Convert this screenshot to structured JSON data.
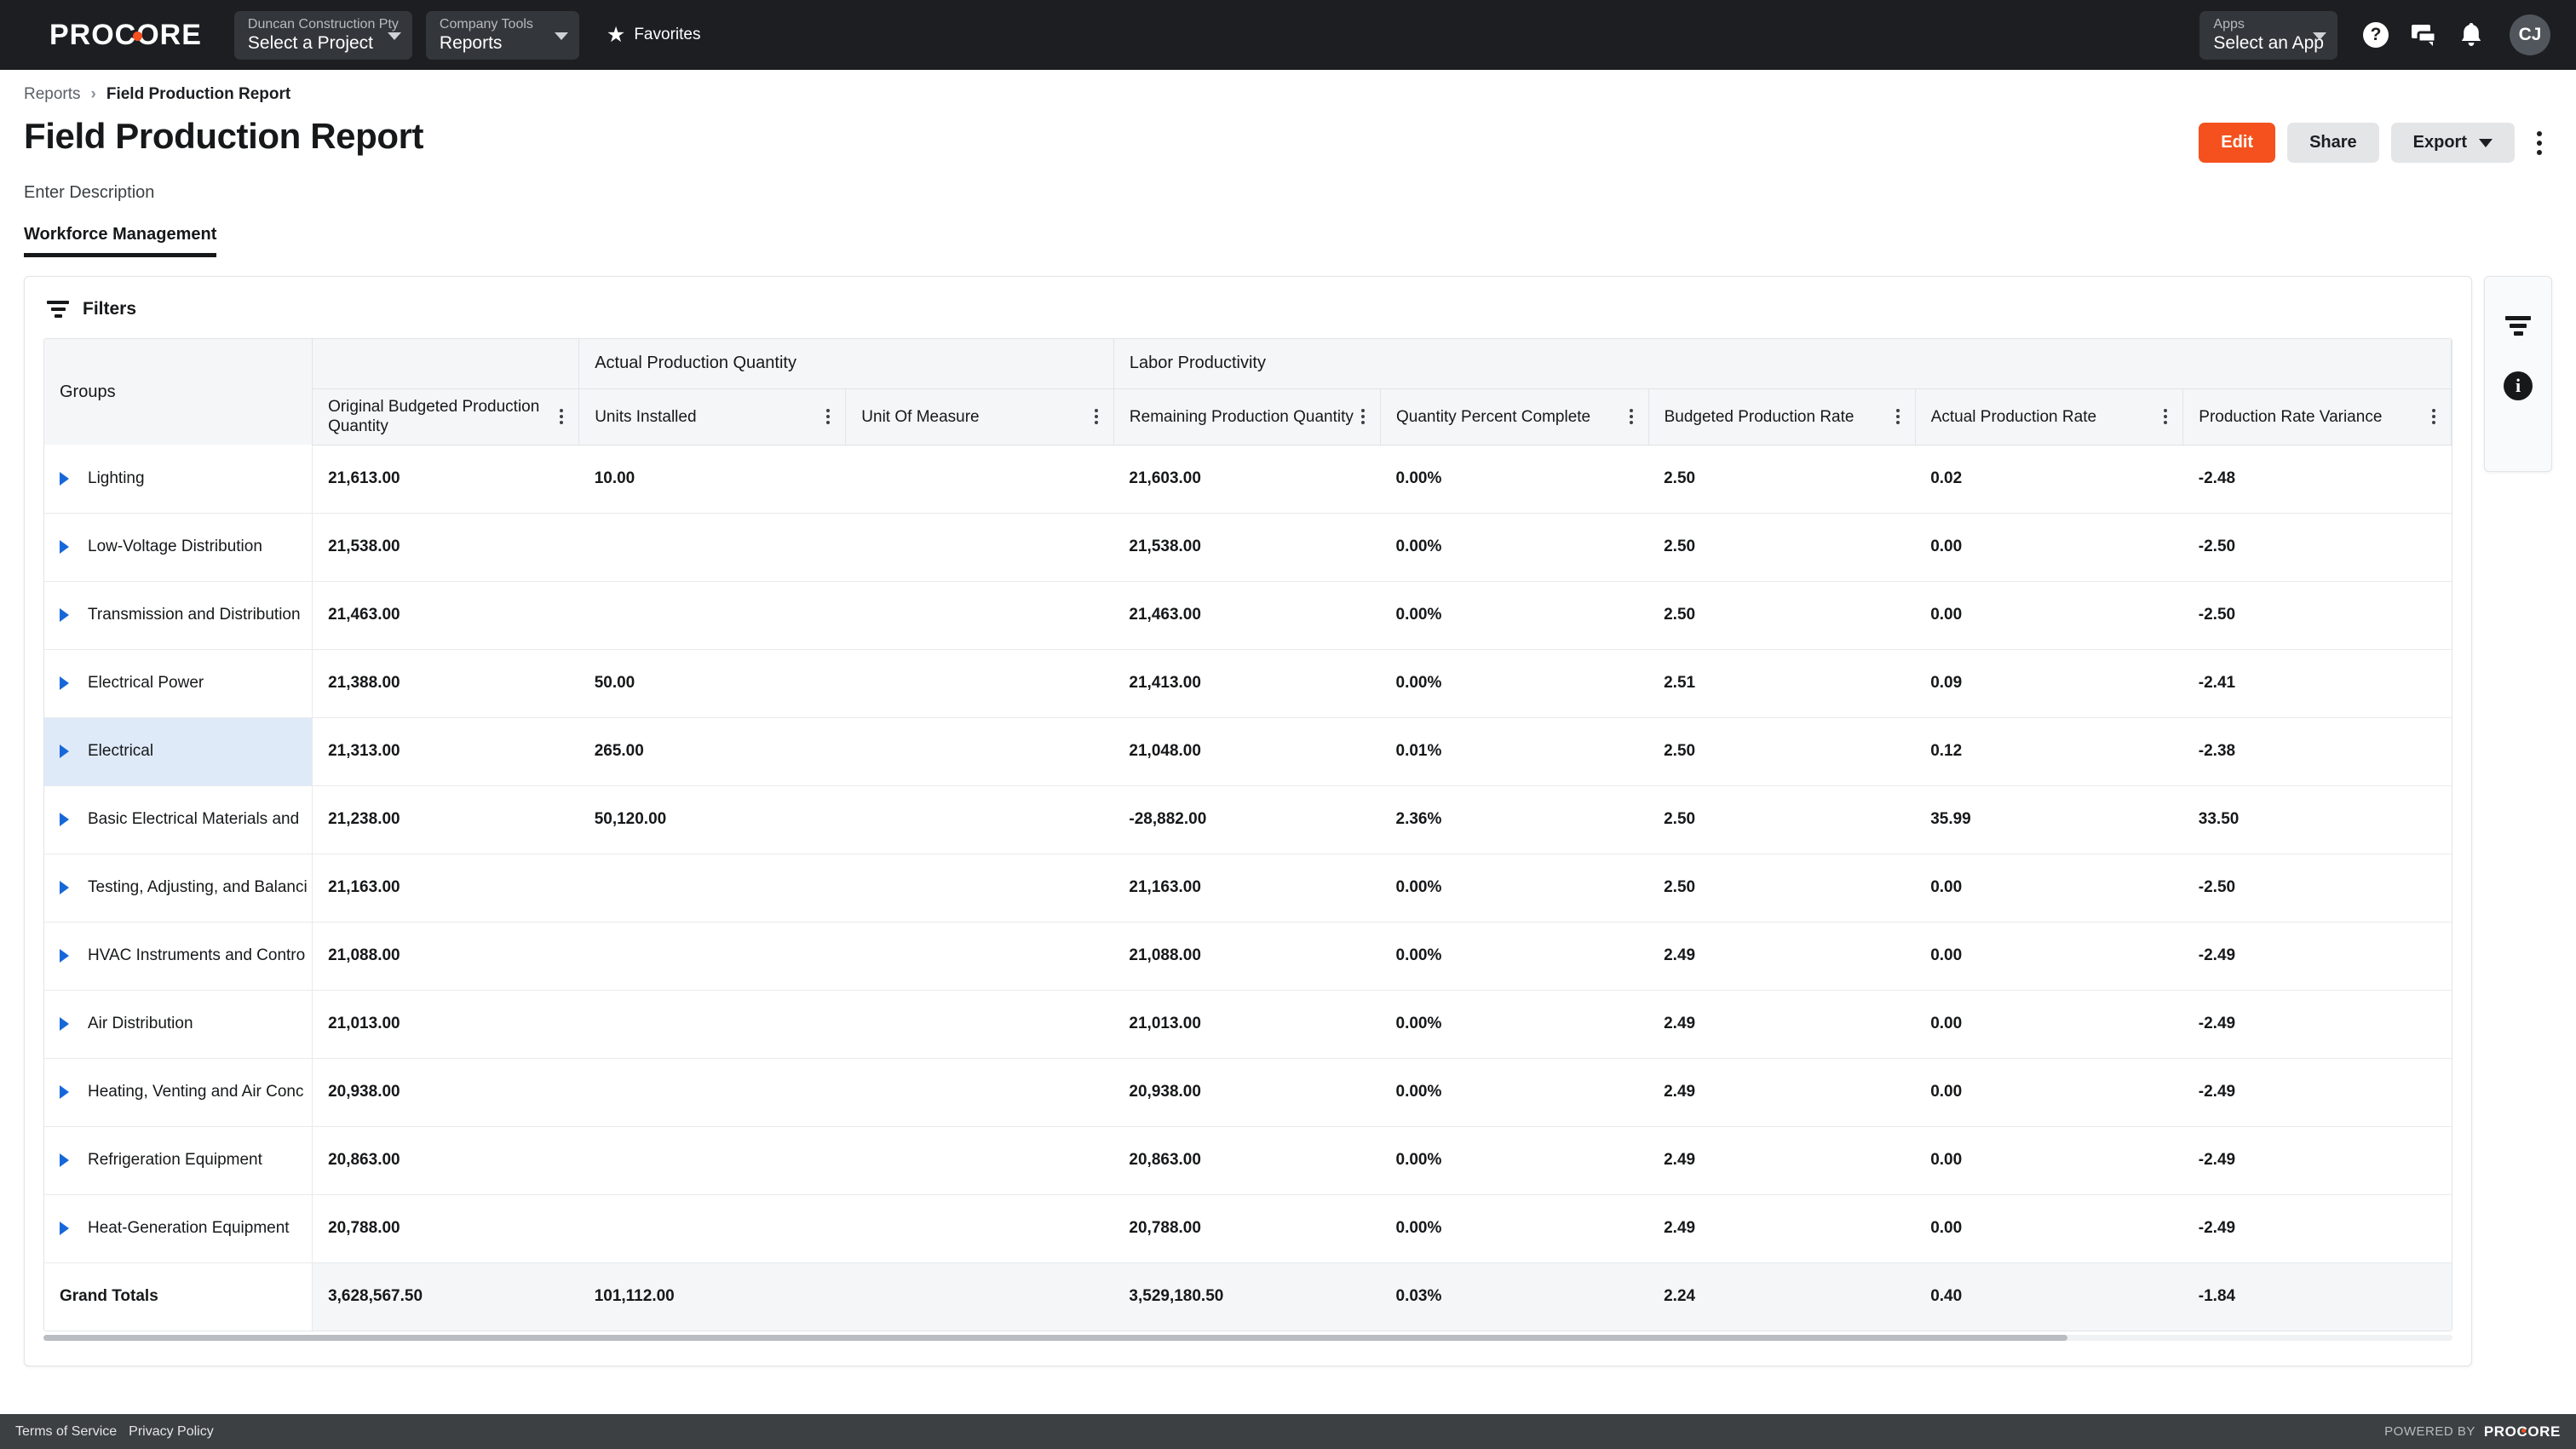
{
  "topnav": {
    "logo": "PROCORE",
    "project_select": {
      "label": "Duncan Construction Pty",
      "value": "Select a Project"
    },
    "tool_select": {
      "label": "Company Tools",
      "value": "Reports"
    },
    "favorites": "Favorites",
    "apps_select": {
      "label": "Apps",
      "value": "Select an App"
    },
    "help_icon": "?",
    "avatar_initials": "CJ"
  },
  "breadcrumb": {
    "parent": "Reports",
    "separator": "›",
    "current": "Field Production Report"
  },
  "header": {
    "title": "Field Production Report",
    "edit_label": "Edit",
    "share_label": "Share",
    "export_label": "Export",
    "description": "Enter Description"
  },
  "tabs": [
    {
      "label": "Workforce Management",
      "active": true
    }
  ],
  "filters": {
    "label": "Filters"
  },
  "rail": {
    "filter_icon": "filter-icon",
    "info_icon": "info-icon"
  },
  "chart_data": {
    "type": "table",
    "title": "Field Production Report",
    "group_bands": [
      {
        "label": "",
        "span": 1
      },
      {
        "label": "",
        "span": 1
      },
      {
        "label": "Actual Production Quantity",
        "span": 2
      },
      {
        "label": "Labor Productivity",
        "span": 5
      }
    ],
    "columns": [
      "Groups",
      "Original Budgeted Production Quantity",
      "Units Installed",
      "Unit Of Measure",
      "Remaining Production Quantity",
      "Quantity Percent Complete",
      "Budgeted Production Rate",
      "Actual Production Rate",
      "Production Rate Variance"
    ],
    "rows": [
      {
        "group": "Lighting",
        "selected": false,
        "values": [
          "21,613.00",
          "10.00",
          "",
          "21,603.00",
          "0.00%",
          "2.50",
          "0.02",
          "-2.48"
        ]
      },
      {
        "group": "Low-Voltage Distribution",
        "selected": false,
        "values": [
          "21,538.00",
          "",
          "",
          "21,538.00",
          "0.00%",
          "2.50",
          "0.00",
          "-2.50"
        ]
      },
      {
        "group": "Transmission and Distribution",
        "selected": false,
        "values": [
          "21,463.00",
          "",
          "",
          "21,463.00",
          "0.00%",
          "2.50",
          "0.00",
          "-2.50"
        ]
      },
      {
        "group": "Electrical Power",
        "selected": false,
        "values": [
          "21,388.00",
          "50.00",
          "",
          "21,413.00",
          "0.00%",
          "2.51",
          "0.09",
          "-2.41"
        ]
      },
      {
        "group": "Electrical",
        "selected": true,
        "values": [
          "21,313.00",
          "265.00",
          "",
          "21,048.00",
          "0.01%",
          "2.50",
          "0.12",
          "-2.38"
        ]
      },
      {
        "group": "Basic Electrical Materials and",
        "selected": false,
        "values": [
          "21,238.00",
          "50,120.00",
          "",
          "-28,882.00",
          "2.36%",
          "2.50",
          "35.99",
          "33.50"
        ]
      },
      {
        "group": "Testing, Adjusting, and Balanci",
        "selected": false,
        "values": [
          "21,163.00",
          "",
          "",
          "21,163.00",
          "0.00%",
          "2.50",
          "0.00",
          "-2.50"
        ]
      },
      {
        "group": "HVAC Instruments and Contro",
        "selected": false,
        "values": [
          "21,088.00",
          "",
          "",
          "21,088.00",
          "0.00%",
          "2.49",
          "0.00",
          "-2.49"
        ]
      },
      {
        "group": "Air Distribution",
        "selected": false,
        "values": [
          "21,013.00",
          "",
          "",
          "21,013.00",
          "0.00%",
          "2.49",
          "0.00",
          "-2.49"
        ]
      },
      {
        "group": "Heating, Venting and Air Conc",
        "selected": false,
        "values": [
          "20,938.00",
          "",
          "",
          "20,938.00",
          "0.00%",
          "2.49",
          "0.00",
          "-2.49"
        ]
      },
      {
        "group": "Refrigeration Equipment",
        "selected": false,
        "values": [
          "20,863.00",
          "",
          "",
          "20,863.00",
          "0.00%",
          "2.49",
          "0.00",
          "-2.49"
        ]
      },
      {
        "group": "Heat-Generation Equipment",
        "selected": false,
        "values": [
          "20,788.00",
          "",
          "",
          "20,788.00",
          "0.00%",
          "2.49",
          "0.00",
          "-2.49"
        ]
      }
    ],
    "totals": {
      "group": "Grand Totals",
      "values": [
        "3,628,567.50",
        "101,112.00",
        "",
        "3,529,180.50",
        "0.03%",
        "2.24",
        "0.40",
        "-1.84"
      ]
    }
  },
  "footer": {
    "terms": "Terms of Service",
    "privacy": "Privacy Policy",
    "powered_by": "POWERED BY",
    "brand": "PROCORE"
  },
  "colors": {
    "accent": "#f4511e",
    "nav_bg": "#1c1e21",
    "selected_row": "#dfeaf9",
    "arrow": "#1668d9"
  }
}
